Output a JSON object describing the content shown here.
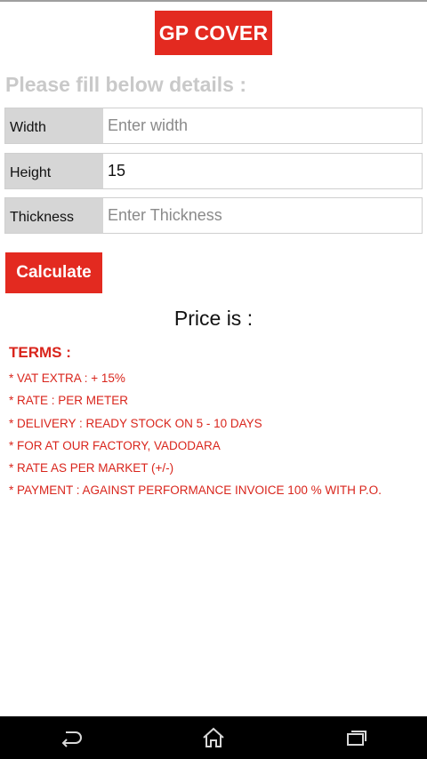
{
  "app": {
    "title": "GP COVER"
  },
  "form": {
    "prompt": "Please fill below details :",
    "fields": [
      {
        "label": "Width",
        "value": "",
        "placeholder": "Enter width"
      },
      {
        "label": "Height",
        "value": "15",
        "placeholder": ""
      },
      {
        "label": "Thickness",
        "value": "",
        "placeholder": "Enter Thickness"
      }
    ],
    "calculate_label": "Calculate"
  },
  "result": {
    "price_label": "Price is :"
  },
  "terms": {
    "title": "TERMS :",
    "items": [
      "* VAT EXTRA : + 15%",
      "* RATE : PER METER",
      "* DELIVERY : READY STOCK ON 5 - 10 DAYS",
      "* FOR AT OUR FACTORY, VADODARA",
      "* RATE AS PER MARKET (+/-)",
      "* PAYMENT :  AGAINST PERFORMANCE INVOICE 100 % WITH P.O."
    ]
  },
  "navbar": {
    "icons": [
      "back-icon",
      "home-icon",
      "recents-icon"
    ]
  },
  "colors": {
    "accent": "#e32a20",
    "terms_text": "#d9251c",
    "label_bg": "#d6d6d6",
    "prompt_text": "#c9c9c9"
  }
}
